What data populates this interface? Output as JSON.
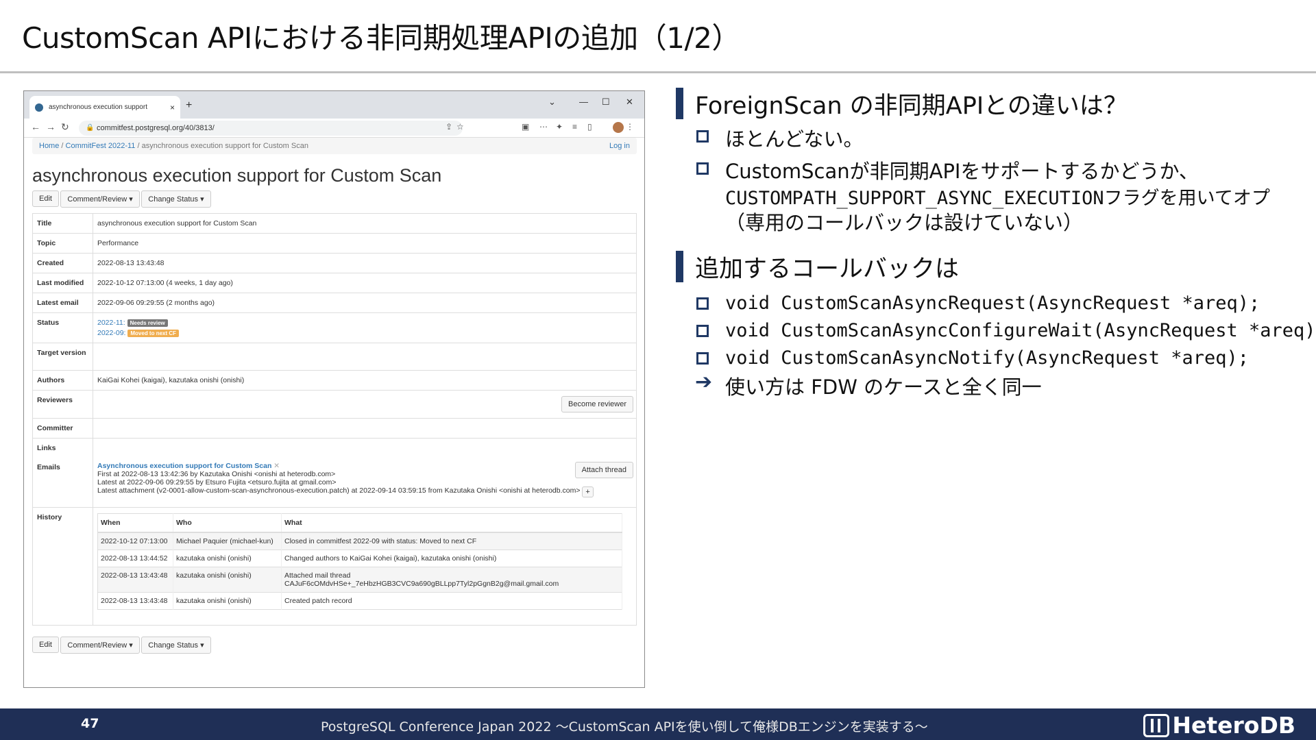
{
  "slide": {
    "title": "CustomScan APIにおける非同期処理APIの追加（1/2）",
    "page_number": "47",
    "footer": "PostgreSQL Conference Japan 2022 〜CustomScan APIを使い倒して俺様DBエンジンを実装する〜",
    "brand": "HeteroDB"
  },
  "browser": {
    "tab_title": "asynchronous execution support",
    "tab_close": "×",
    "new_tab": "+",
    "url": "commitfest.postgresql.org/40/3813/",
    "window_controls": [
      "⌄",
      "—",
      "☐",
      "✕"
    ]
  },
  "page": {
    "breadcrumb": {
      "home": "Home",
      "sep": "/",
      "cf": "CommitFest 2022-11",
      "current": "asynchronous execution support for Custom Scan",
      "login": "Log in"
    },
    "title": "asynchronous execution support for Custom Scan",
    "buttons": {
      "edit": "Edit",
      "comment": "Comment/Review ▾",
      "change_status": "Change Status ▾",
      "become_reviewer": "Become reviewer",
      "attach_thread": "Attach thread"
    },
    "fields": {
      "title_k": "Title",
      "title_v": "asynchronous execution support for Custom Scan",
      "topic_k": "Topic",
      "topic_v": "Performance",
      "created_k": "Created",
      "created_v": "2022-08-13 13:43:48",
      "modified_k": "Last modified",
      "modified_v": "2022-10-12 07:13:00 (4 weeks, 1 day ago)",
      "email_k": "Latest email",
      "email_v": "2022-09-06 09:29:55 (2 months ago)",
      "status_k": "Status",
      "status_1_cf": "2022-11:",
      "status_1_label": "Needs review",
      "status_2_cf": "2022-09:",
      "status_2_label": "Moved to next CF",
      "target_k": "Target version",
      "authors_k": "Authors",
      "authors_v": "KaiGai Kohei (kaigai), kazutaka onishi (onishi)",
      "reviewers_k": "Reviewers",
      "committer_k": "Committer",
      "links_k": "Links",
      "emails_k": "Emails",
      "thread_title": "Asynchronous execution support for Custom Scan",
      "thread_x": "✕",
      "first_at": "First at 2022-08-13 13:42:36 by Kazutaka Onishi <onishi at heterodb.com>",
      "latest_at": "Latest at 2022-09-06 09:29:55 by Etsuro Fujita <etsuro.fujita at gmail.com>",
      "latest_attach": "Latest attachment (v2-0001-allow-custom-scan-asynchronous-execution.patch) at 2022-09-14 03:59:15 from Kazutaka Onishi <onishi at heterodb.com>",
      "plus": "+",
      "history_k": "History"
    },
    "history": {
      "headers": [
        "When",
        "Who",
        "What"
      ],
      "rows": [
        [
          "2022-10-12 07:13:00",
          "Michael Paquier (michael-kun)",
          "Closed in commitfest 2022-09 with status: Moved to next CF"
        ],
        [
          "2022-08-13 13:44:52",
          "kazutaka onishi (onishi)",
          "Changed authors to KaiGai Kohei (kaigai), kazutaka onishi (onishi)"
        ],
        [
          "2022-08-13 13:43:48",
          "kazutaka onishi (onishi)",
          "Attached mail thread CAJuF6cOMdvHSe+_7eHbzHGB3CVC9a690gBLLpp7Tyl2pGgnB2g@mail.gmail.com"
        ],
        [
          "2022-08-13 13:43:48",
          "kazutaka onishi (onishi)",
          "Created patch record"
        ]
      ]
    }
  },
  "notes": {
    "sec1": "ForeignScan の非同期APIとの違いは？",
    "sec1_items": [
      "ほとんどない。",
      "CustomScanが非同期APIをサポートするかどうか、",
      "CUSTOMPATH_SUPPORT_ASYNC_EXECUTIONフラグを用いてオプ",
      "（専用のコールバックは設けていない）"
    ],
    "sec2": "追加するコールバックは",
    "sec2_items": [
      "void CustomScanAsyncRequest(AsyncRequest *areq);",
      "void CustomScanAsyncConfigureWait(AsyncRequest *areq);",
      "void CustomScanAsyncNotify(AsyncRequest *areq);"
    ],
    "conclusion": "使い方は FDW のケースと全く同一",
    "accent_color": "#1f3864"
  }
}
